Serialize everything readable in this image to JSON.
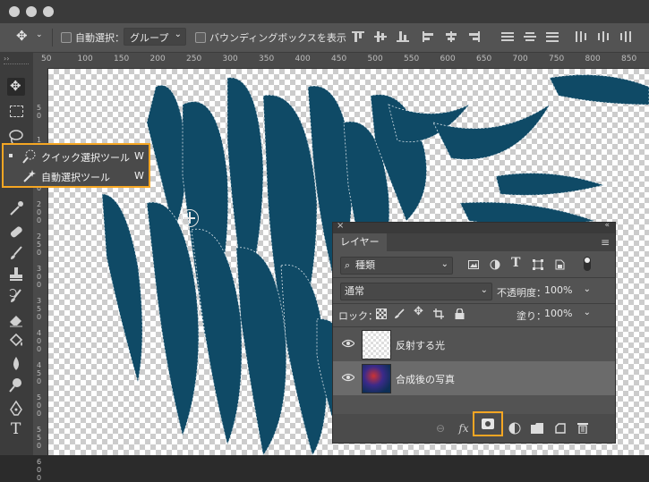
{
  "options_bar": {
    "auto_select_label": "自動選択：",
    "auto_select_value": "グループ",
    "bounding_box_label": "バウンディングボックスを表示"
  },
  "ruler": {
    "top_ticks": [
      "50",
      "100",
      "150",
      "200",
      "250",
      "300",
      "350",
      "400",
      "450",
      "500",
      "550",
      "600",
      "650",
      "700",
      "750",
      "800",
      "850"
    ],
    "left_ticks": [
      "50",
      "100",
      "150",
      "200",
      "250",
      "300",
      "350",
      "400",
      "450",
      "500",
      "550",
      "600"
    ]
  },
  "flyout": {
    "items": [
      {
        "label": "クイック選択ツール",
        "shortcut": "W"
      },
      {
        "label": "自動選択ツール",
        "shortcut": "W"
      }
    ]
  },
  "layers_panel": {
    "tab_label": "レイヤー",
    "filter_value": "種類",
    "blend_mode": "通常",
    "opacity_label": "不透明度：",
    "opacity_value": "100%",
    "lock_label": "ロック：",
    "fill_label": "塗り：",
    "fill_value": "100%",
    "layers": [
      {
        "name": "反射する光"
      },
      {
        "name": "合成後の写真"
      }
    ],
    "fx_label": "fx"
  },
  "colors": {
    "highlight": "#f5a623",
    "fish": "#0f4a66"
  }
}
